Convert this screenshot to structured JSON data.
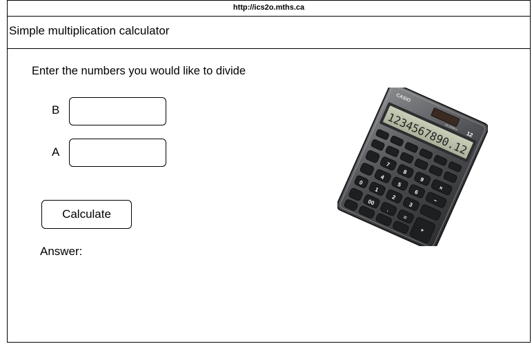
{
  "browser": {
    "url": "http://ics2o.mths.ca"
  },
  "page": {
    "title": "Simple multiplication calculator",
    "prompt": "Enter the numbers you would like to divide",
    "field_b_label": "B",
    "field_a_label": "A",
    "field_b_value": "",
    "field_a_value": "",
    "calculate_label": "Calculate",
    "answer_label": "Answer:"
  },
  "calculator_image": {
    "brand": "CASIO",
    "display": "1234567890.12",
    "badge": "12",
    "model": "JS-20WKA"
  }
}
